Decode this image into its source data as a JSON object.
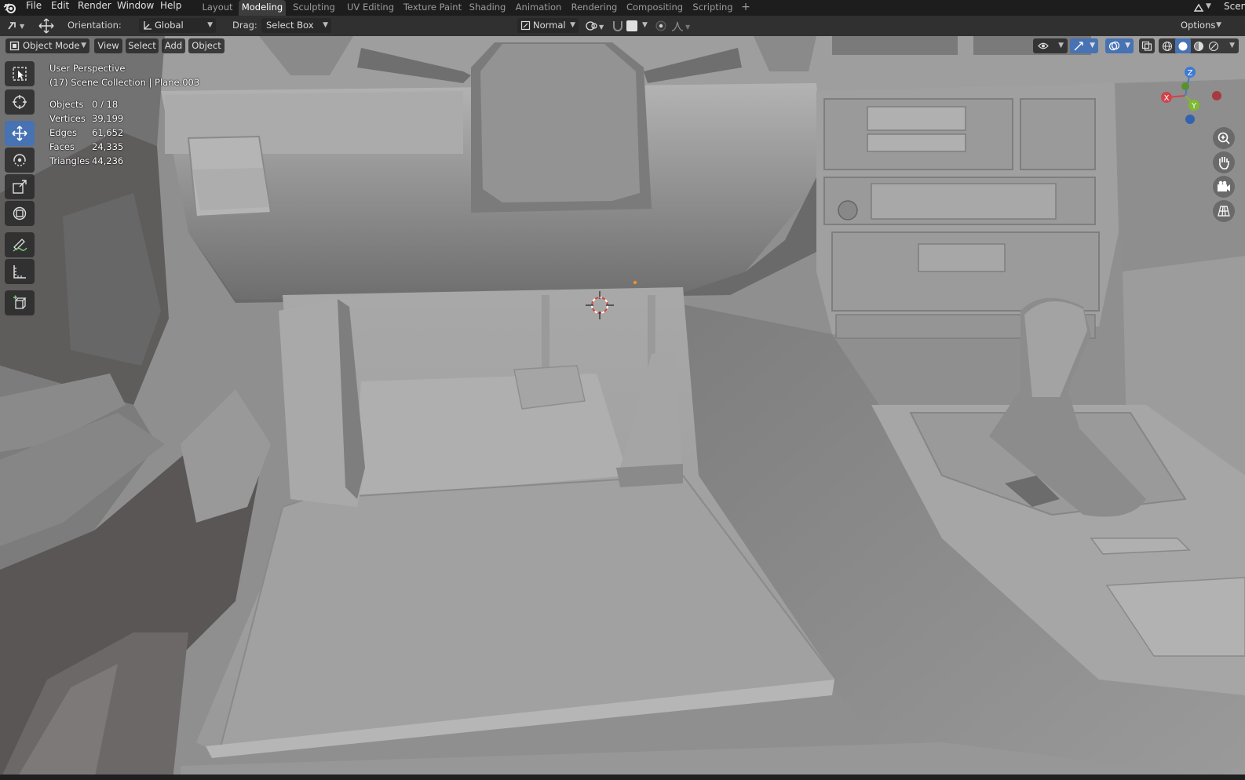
{
  "topbar": {
    "menus": [
      "File",
      "Edit",
      "Render",
      "Window",
      "Help"
    ],
    "workspaces": [
      "Layout",
      "Modeling",
      "Sculpting",
      "UV Editing",
      "Texture Paint",
      "Shading",
      "Animation",
      "Rendering",
      "Compositing",
      "Scripting"
    ],
    "active_workspace": "Modeling",
    "add_workspace": "+",
    "scene_label": "Scen"
  },
  "tool_header": {
    "orientation_label": "Orientation:",
    "orientation_value": "Global",
    "drag_label": "Drag:",
    "drag_value": "Select Box",
    "pivot_value": "Normal",
    "options_label": "Options"
  },
  "viewport_header": {
    "mode": "Object Mode",
    "view": "View",
    "select": "Select",
    "add": "Add",
    "object": "Object"
  },
  "overlay": {
    "perspective": "User Perspective",
    "collection": "(17) Scene Collection | Plane.003",
    "stats": [
      {
        "label": "Objects",
        "value": "0 / 18"
      },
      {
        "label": "Vertices",
        "value": "39,199"
      },
      {
        "label": "Edges",
        "value": "61,652"
      },
      {
        "label": "Faces",
        "value": "24,335"
      },
      {
        "label": "Triangles",
        "value": "44,236"
      }
    ]
  },
  "gizmo": {
    "x": "X",
    "y": "Y",
    "z": "Z"
  },
  "tools": [
    "select-box-icon",
    "cursor-icon",
    "move-icon",
    "rotate-icon",
    "scale-icon",
    "transform-icon",
    "annotate-icon",
    "measure-icon",
    "add-cube-icon"
  ],
  "colors": {
    "accent": "#4772b3",
    "header": "#1d1d1d",
    "toolheader": "#303030"
  }
}
